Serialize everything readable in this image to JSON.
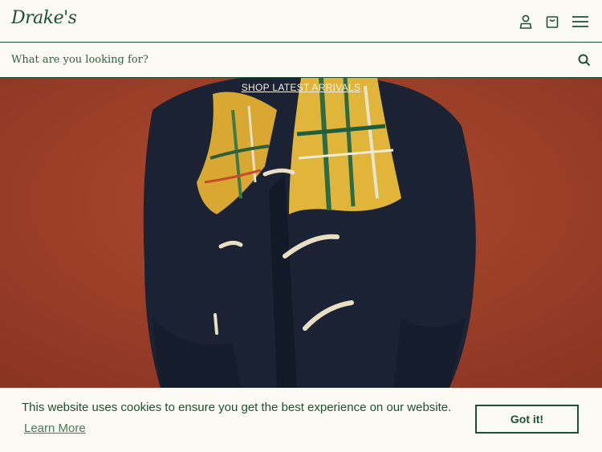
{
  "header": {
    "logo_text": "Drake's",
    "icons": [
      "account-icon",
      "bag-icon",
      "menu-icon"
    ]
  },
  "search": {
    "placeholder": "What are you looking for?",
    "icon": "search-icon"
  },
  "hero": {
    "link_label": "SHOP LATEST ARRIVALS"
  },
  "cookie_banner": {
    "message": "This website uses cookies to ensure you get the best experience on our website.",
    "learn_more": "Learn More",
    "accept_label": "Got it!"
  },
  "colors": {
    "brand_green": "#1f4f33",
    "background": "#fbfaf5",
    "hero_wall": "#a0412a",
    "coat_navy": "#1a2233"
  }
}
